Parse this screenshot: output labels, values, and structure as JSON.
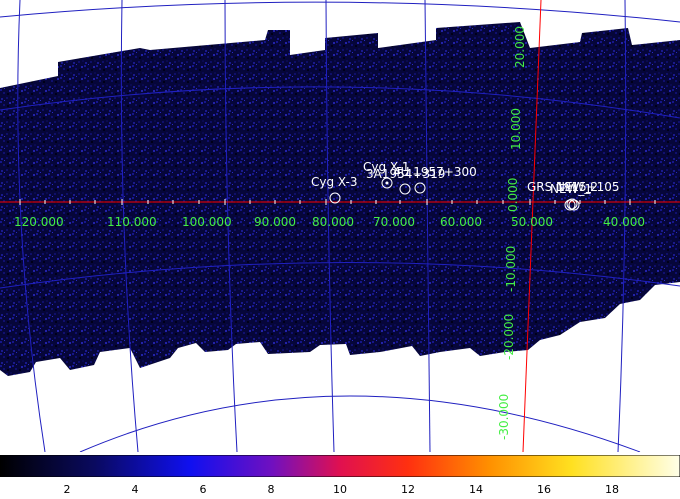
{
  "sources": [
    {
      "name": "Cyg X-3"
    },
    {
      "name": "Cyg X-1"
    },
    {
      "name": "3A1954+319"
    },
    {
      "name": "4U 1957+300"
    },
    {
      "name": "GRS 1915+105"
    },
    {
      "name": "NEW_1"
    },
    {
      "name": "NEW_2"
    }
  ],
  "grid_labels": {
    "longitude": [
      "120.000",
      "110.000",
      "100.000",
      "90.000",
      "80.000",
      "70.000",
      "60.000",
      "50.000",
      "40.000"
    ],
    "latitude": [
      "20.000",
      "10.000",
      "0.000",
      "-10.000",
      "-20.000",
      "-30.000"
    ]
  },
  "colorbar": {
    "ticks": [
      "2",
      "4",
      "6",
      "8",
      "10",
      "12",
      "14",
      "16",
      "18"
    ]
  },
  "colors": {
    "grid": "#2020c0",
    "axis": "#ff0000",
    "label": "#44ee44",
    "source": "#ffffff"
  }
}
